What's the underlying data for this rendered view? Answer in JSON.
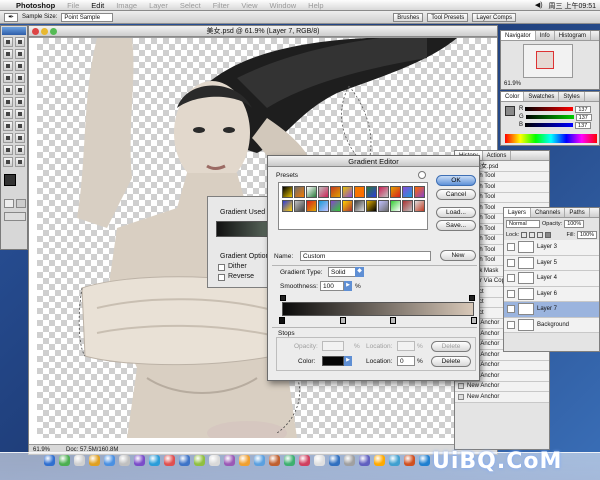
{
  "menubar": {
    "apple": "",
    "app": "Photoshop",
    "items": [
      "File",
      "Edit",
      "Image",
      "Layer",
      "Select",
      "Filter",
      "View",
      "Window",
      "Help"
    ],
    "clock": "周三 上午09:51"
  },
  "options": {
    "sample_label": "Sample Size:",
    "sample_value": "Point Sample",
    "well_tabs": [
      "Brushes",
      "Tool Presets",
      "Layer Comps"
    ]
  },
  "document": {
    "title": "美女.psd @ 61.9% (Layer 7, RGB/8)",
    "zoom": "61.9%",
    "doc_size": "Doc: 57.5M/160.8M"
  },
  "navigator": {
    "tabs": [
      "Navigator",
      "Info",
      "Histogram"
    ],
    "zoom": "61.9%"
  },
  "color": {
    "tabs": [
      "Color",
      "Swatches",
      "Styles"
    ],
    "channels": [
      {
        "label": "R",
        "value": "137"
      },
      {
        "label": "G",
        "value": "137"
      },
      {
        "label": "B",
        "value": "137"
      }
    ]
  },
  "history": {
    "tabs": [
      "History",
      "Actions"
    ],
    "snapshot": "美女.psd",
    "items": [
      "Brush Tool",
      "Brush Tool",
      "Brush Tool",
      "Brush Tool",
      "Brush Tool",
      "Brush Tool",
      "Brush Tool",
      "Brush Tool",
      "Brush Tool",
      "Quick Mask",
      "Layer Via Copy",
      "Select",
      "Select",
      "Select",
      "New Anchor",
      "New Anchor",
      "New Anchor",
      "New Anchor",
      "New Anchor",
      "New Anchor",
      "New Anchor",
      "New Anchor"
    ]
  },
  "layers": {
    "tabs": [
      "Layers",
      "Channels",
      "Paths"
    ],
    "blend": "Normal",
    "opacity_label": "Opacity:",
    "opacity": "100%",
    "lock_label": "Lock:",
    "fill_label": "Fill:",
    "fill": "100%",
    "items": [
      {
        "name": "Layer 3",
        "selected": false
      },
      {
        "name": "Layer 5",
        "selected": false
      },
      {
        "name": "Layer 4",
        "selected": false
      },
      {
        "name": "Layer 6",
        "selected": false
      },
      {
        "name": "Layer 7",
        "selected": true
      },
      {
        "name": "Background",
        "selected": false
      }
    ]
  },
  "gradient_used": {
    "title": "Gradient Used fo",
    "options": "Gradient Options",
    "dither": "Dither",
    "reverse": "Reverse"
  },
  "gradient_editor": {
    "title": "Gradient Editor",
    "presets_label": "Presets",
    "buttons": {
      "ok": "OK",
      "cancel": "Cancel",
      "load": "Load...",
      "save": "Save...",
      "new": "New",
      "delete": "Delete"
    },
    "name_label": "Name:",
    "name_value": "Custom",
    "type_label": "Gradient Type:",
    "type_value": "Solid",
    "smooth_label": "Smoothness:",
    "smooth_value": "100",
    "percent": "%",
    "stops_label": "Stops",
    "opacity_label": "Opacity:",
    "location_label": "Location:",
    "color_label": "Color:",
    "color_location": "0",
    "stop_color": "#050505",
    "ramp_start": "#0a0a0a",
    "ramp_end": "#d8c8b8",
    "color_stop_positions": [
      0,
      0.32,
      0.58,
      1.0
    ],
    "presets": [
      "#000000",
      "#6d6d6d",
      "#ffffff",
      "#bfbfbf",
      "#c23b22",
      "#e6c200",
      "#f27a00",
      "#2c7a3c",
      "#cc2255",
      "#e0a000",
      "#8a4bd8",
      "#ff6a00",
      "#2e3bd8",
      "#c0c0c0",
      "#d82020",
      "#1a9ad8",
      "#8844cc",
      "#ffd000",
      "#444444",
      "#ddaa00",
      "#c0c0ff",
      "#33cc33",
      "#aa3333",
      "#dddddd"
    ]
  },
  "dock": {
    "icon_colors": [
      "#2f6fd0",
      "#4caf50",
      "#d0d0d0",
      "#e0a020",
      "#4a90e2",
      "#c0c0c0",
      "#7b4cc9",
      "#2b9dd9",
      "#e05050",
      "#3e74c8",
      "#90c040",
      "#d9d9d9",
      "#9b59b6",
      "#f0a030",
      "#5aa0e0",
      "#c06030",
      "#3db070",
      "#d04060",
      "#e0e0e0",
      "#3070c0",
      "#a0a0a0",
      "#6060c0",
      "#ffaa00",
      "#40a0d0",
      "#d05020",
      "#2080d0"
    ],
    "watermark": "UiBQ.CoM"
  }
}
